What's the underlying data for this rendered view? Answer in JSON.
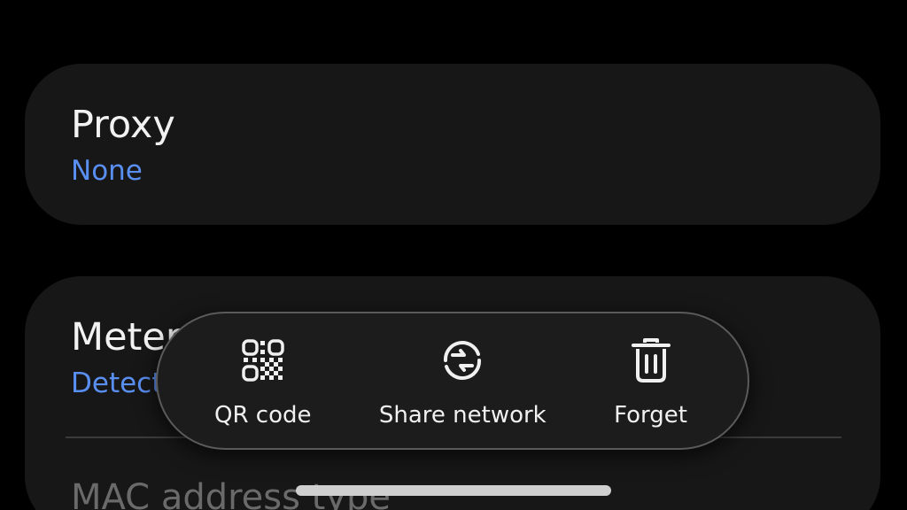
{
  "proxy": {
    "title": "Proxy",
    "value": "None"
  },
  "metered": {
    "title": "Metered network",
    "value": "Detect automatically"
  },
  "mac": {
    "title": "MAC address type"
  },
  "actions": {
    "qr_code": {
      "label": "QR code",
      "icon": "qr-code-icon"
    },
    "share_network": {
      "label": "Share network",
      "icon": "share-network-icon"
    },
    "forget": {
      "label": "Forget",
      "icon": "trash-icon"
    }
  },
  "colors": {
    "background": "#000000",
    "card": "#171717",
    "accent": "#5a8ff2",
    "text": "#f2f2f2",
    "popup": "#1c1c1c"
  }
}
